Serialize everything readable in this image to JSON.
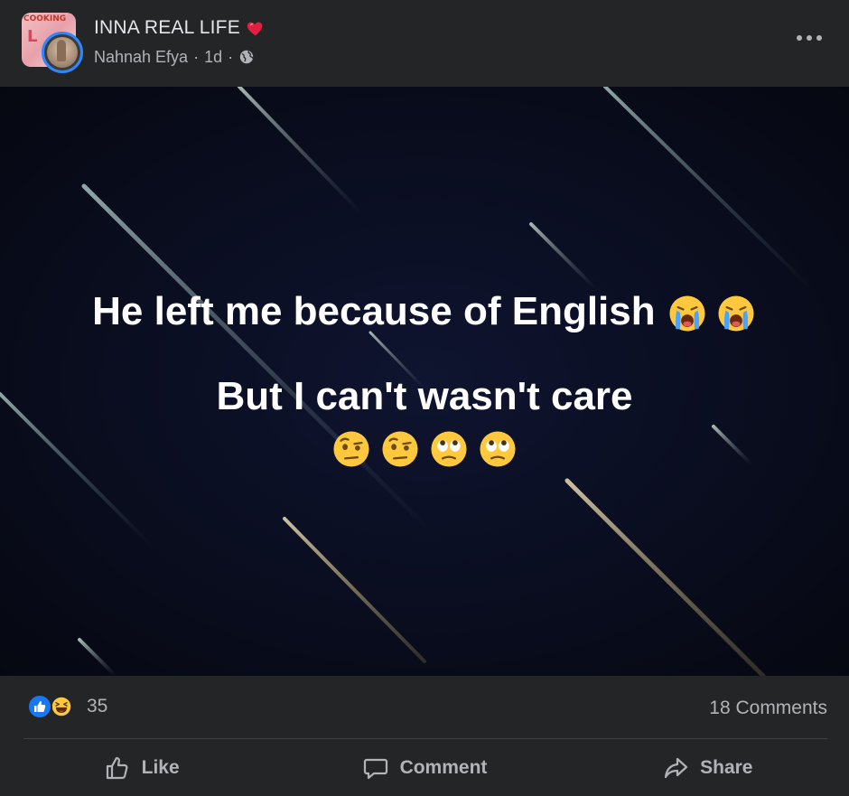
{
  "header": {
    "group_name": "INNA REAL LIFE",
    "author": "Nahnah Efya",
    "separator": "·",
    "time": "1d",
    "separator2": "·",
    "group_avatar_text": "COOKING",
    "group_avatar_letter": "L"
  },
  "post": {
    "line1": "He left me because of English",
    "line2": "But I can't wasn't care"
  },
  "stats": {
    "reaction_count": "35",
    "comments": "18 Comments"
  },
  "actions": {
    "like": "Like",
    "comment": "Comment",
    "share": "Share"
  },
  "colors": {
    "background": "#242526",
    "image_bg": "#0a0e1e",
    "text_primary": "#e4e6eb",
    "text_secondary": "#b0b3b8",
    "accent_blue": "#1877f2",
    "heart_red": "#e41e3f"
  },
  "icons": [
    "heart-icon",
    "globe-icon",
    "more-icon",
    "like-reaction-icon",
    "haha-reaction-icon",
    "crying-emoji",
    "raised-eyebrow-emoji",
    "eye-roll-emoji",
    "thumbs-up-icon",
    "comment-icon",
    "share-icon"
  ]
}
